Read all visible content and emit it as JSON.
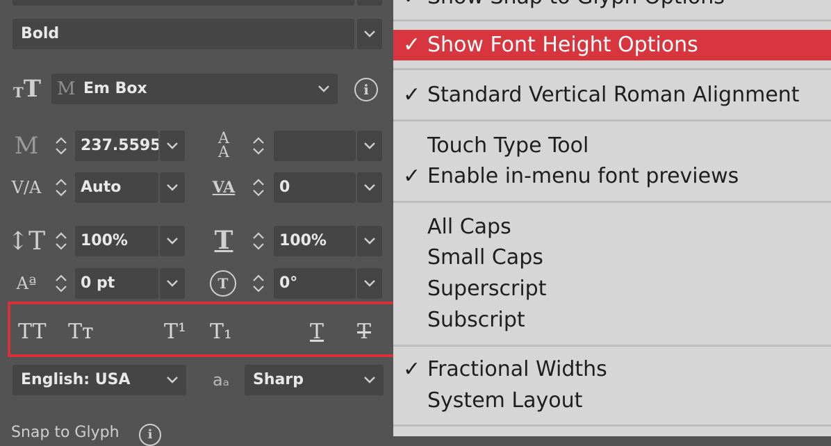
{
  "panel": {
    "font_style": "Bold",
    "height_ref": {
      "label": "Em Box",
      "glyph": "M"
    },
    "font_size": "237.5595",
    "leading": "",
    "kerning": "Auto",
    "tracking": "0",
    "vertical_scale": "100%",
    "horizontal_scale": "100%",
    "baseline_shift": "0 pt",
    "rotation": "0°",
    "style_buttons": [
      "TT",
      "Tт",
      "T¹",
      "T₁",
      "T",
      "T"
    ],
    "language": "English: USA",
    "aa_label": "aₐ",
    "antialias": "Sharp",
    "snap_label": "Snap to Glyph"
  },
  "menu": {
    "top_item": "Show Snap to Glyph Options",
    "groups": [
      {
        "items": [
          {
            "label": "Show Font Height Options",
            "checked": true,
            "highlighted": true
          }
        ]
      },
      {
        "items": [
          {
            "label": "Standard Vertical Roman Alignment",
            "checked": true
          }
        ]
      },
      {
        "items": [
          {
            "label": "Touch Type Tool",
            "checked": false
          },
          {
            "label": "Enable in-menu font previews",
            "checked": true
          }
        ]
      },
      {
        "items": [
          {
            "label": "All Caps",
            "checked": false
          },
          {
            "label": "Small Caps",
            "checked": false
          },
          {
            "label": "Superscript",
            "checked": false
          },
          {
            "label": "Subscript",
            "checked": false
          }
        ]
      },
      {
        "items": [
          {
            "label": "Fractional Widths",
            "checked": true
          },
          {
            "label": "System Layout",
            "checked": false
          }
        ]
      }
    ],
    "check_glyph": "✓"
  },
  "colors": {
    "highlight": "#d8363e",
    "panel_bg": "#535353",
    "menu_bg": "#d6d6d6"
  }
}
